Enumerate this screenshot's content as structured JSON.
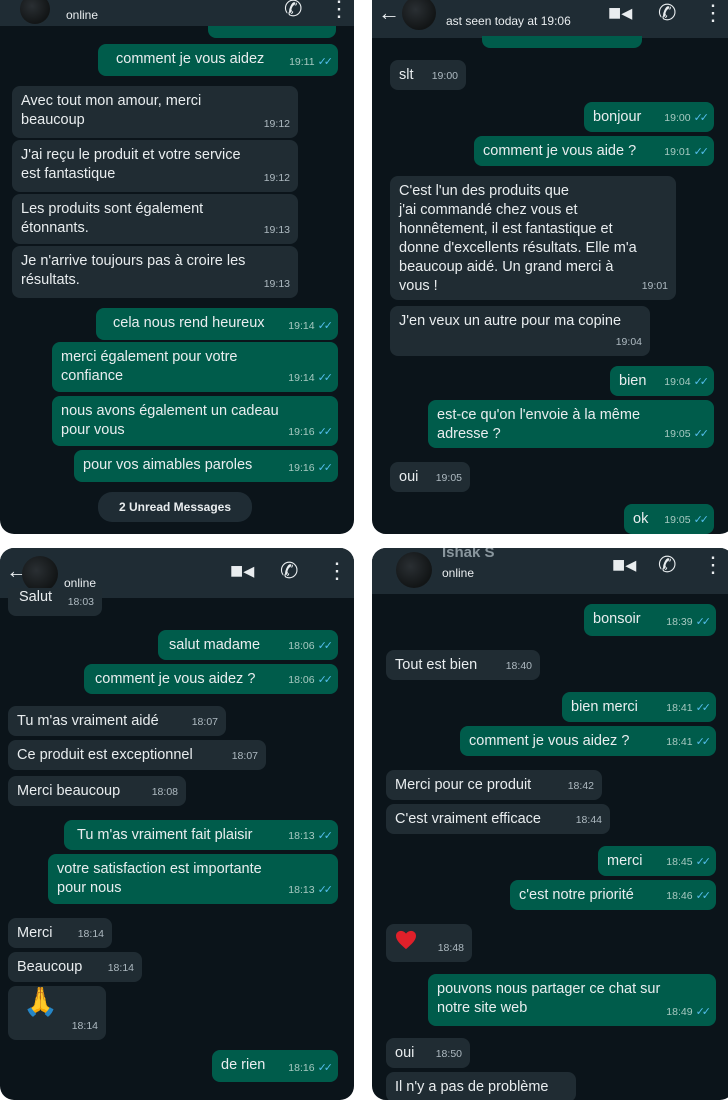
{
  "tl": {
    "status": "online",
    "messages": [
      {
        "dir": "out",
        "text": "comment je vous aidez",
        "time": "19:11",
        "ticks": true
      },
      {
        "dir": "in",
        "text": "Avec tout mon amour, merci\nbeaucoup",
        "time": "19:12"
      },
      {
        "dir": "in",
        "text": "J'ai reçu le produit et votre service\nest fantastique",
        "time": "19:12"
      },
      {
        "dir": "in",
        "text": "Les produits sont également\nétonnants.",
        "time": "19:13"
      },
      {
        "dir": "in",
        "text": "Je n'arrive toujours pas à croire les\nrésultats.",
        "time": "19:13"
      },
      {
        "dir": "out",
        "text": "cela nous rend heureux",
        "time": "19:14",
        "ticks": true
      },
      {
        "dir": "out",
        "text": "merci également pour votre\nconfiance",
        "time": "19:14",
        "ticks": true
      },
      {
        "dir": "out",
        "text": "nous avons également un cadeau\npour vous",
        "time": "19:16",
        "ticks": true
      },
      {
        "dir": "out",
        "text": "pour vos aimables paroles",
        "time": "19:16",
        "ticks": true
      }
    ],
    "unread": "2 Unread Messages"
  },
  "tr": {
    "status": "ast seen today at 19:06",
    "messages": [
      {
        "dir": "in",
        "text": "slt",
        "time": "19:00"
      },
      {
        "dir": "out",
        "text": "bonjour",
        "time": "19:00",
        "ticks": true
      },
      {
        "dir": "out",
        "text": "comment je vous aide ?",
        "time": "19:01",
        "ticks": true
      },
      {
        "dir": "in",
        "text": "C'est l'un des produits que\nj'ai commandé chez vous et\nhonnêtement, il est fantastique et\ndonne d'excellents résultats. Elle m'a\nbeaucoup aidé. Un grand merci à\nvous !",
        "time": "19:01"
      },
      {
        "dir": "in",
        "text": "J'en veux un autre pour ma copine",
        "time": "19:04"
      },
      {
        "dir": "out",
        "text": "bien",
        "time": "19:04",
        "ticks": true
      },
      {
        "dir": "out",
        "text": "est-ce qu'on l'envoie à la même\nadresse ?",
        "time": "19:05",
        "ticks": true
      },
      {
        "dir": "in",
        "text": "oui",
        "time": "19:05"
      },
      {
        "dir": "out",
        "text": "ok",
        "time": "19:05",
        "ticks": true
      }
    ]
  },
  "bl": {
    "status": "online",
    "messages": [
      {
        "dir": "in",
        "text": "Salut",
        "time": "18:03"
      },
      {
        "dir": "out",
        "text": "salut madame",
        "time": "18:06",
        "ticks": true
      },
      {
        "dir": "out",
        "text": "comment je vous aidez ?",
        "time": "18:06",
        "ticks": true
      },
      {
        "dir": "in",
        "text": "Tu m'as vraiment aidé",
        "time": "18:07"
      },
      {
        "dir": "in",
        "text": "Ce produit est exceptionnel",
        "time": "18:07"
      },
      {
        "dir": "in",
        "text": "Merci beaucoup",
        "time": "18:08"
      },
      {
        "dir": "out",
        "text": "Tu m'as vraiment fait plaisir",
        "time": "18:13",
        "ticks": true
      },
      {
        "dir": "out",
        "text": "votre satisfaction est importante\npour nous",
        "time": "18:13",
        "ticks": true
      },
      {
        "dir": "in",
        "text": "Merci",
        "time": "18:14"
      },
      {
        "dir": "in",
        "text": "Beaucoup",
        "time": "18:14"
      },
      {
        "dir": "in",
        "text": "🙏",
        "time": "18:14",
        "icon": "praying-hands-icon"
      },
      {
        "dir": "out",
        "text": "de rien",
        "time": "18:16",
        "ticks": true
      }
    ]
  },
  "br": {
    "name": "Ishak S",
    "status": "online",
    "messages": [
      {
        "dir": "out",
        "text": "bonsoir",
        "time": "18:39",
        "ticks": true
      },
      {
        "dir": "in",
        "text": "Tout est bien",
        "time": "18:40"
      },
      {
        "dir": "out",
        "text": "bien merci",
        "time": "18:41",
        "ticks": true
      },
      {
        "dir": "out",
        "text": "comment je vous aidez ?",
        "time": "18:41",
        "ticks": true
      },
      {
        "dir": "in",
        "text": "Merci pour ce produit",
        "time": "18:42"
      },
      {
        "dir": "in",
        "text": "C'est vraiment efficace",
        "time": "18:44"
      },
      {
        "dir": "out",
        "text": "merci",
        "time": "18:45",
        "ticks": true
      },
      {
        "dir": "out",
        "text": "c'est notre priorité",
        "time": "18:46",
        "ticks": true
      },
      {
        "dir": "in",
        "text": "",
        "time": "18:48",
        "icon": "red-heart-icon"
      },
      {
        "dir": "out",
        "text": "pouvons nous partager ce chat sur\nnotre site web",
        "time": "18:49",
        "ticks": true
      },
      {
        "dir": "in",
        "text": "oui",
        "time": "18:50"
      },
      {
        "dir": "in",
        "text": "Il n'y a pas de problème",
        "time": ""
      }
    ]
  },
  "tick_glyph": "✓✓"
}
